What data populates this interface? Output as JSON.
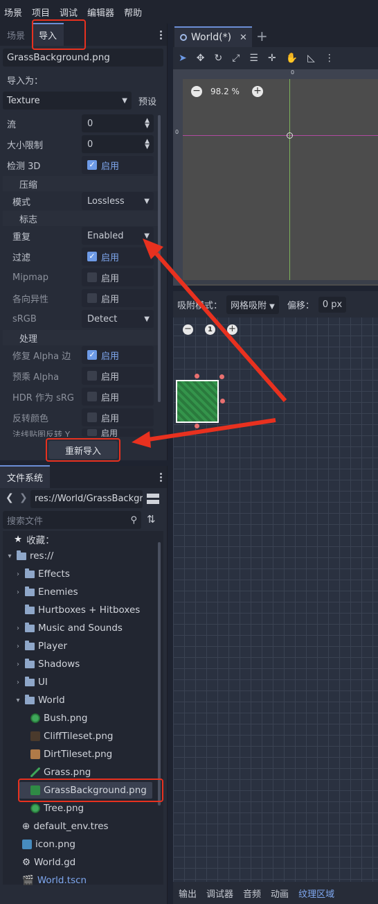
{
  "menu": [
    "场景",
    "项目",
    "调试",
    "编辑器",
    "帮助"
  ],
  "left_tabs": {
    "scene": "场景",
    "import": "导入"
  },
  "import": {
    "file_name": "GrassBackground.png",
    "import_as_label": "导入为：",
    "import_type": "Texture",
    "preset_label": "预设",
    "rows": {
      "stream": {
        "label": "流",
        "value": "0"
      },
      "size_limit": {
        "label": "大小限制",
        "value": "0"
      },
      "detect_3d": {
        "label": "检测 3D",
        "value": "启用"
      },
      "compress_section": "压缩",
      "mode": {
        "label": "模式",
        "value": "Lossless"
      },
      "flags_section": "标志",
      "repeat": {
        "label": "重复",
        "value": "Enabled"
      },
      "filter": {
        "label": "过滤",
        "value": "启用"
      },
      "mipmap": {
        "label": "Mipmap",
        "value": "启用"
      },
      "anisotropic": {
        "label": "各向异性",
        "value": "启用"
      },
      "srgb": {
        "label": "sRGB",
        "value": "Detect"
      },
      "process_section": "处理",
      "fix_alpha": {
        "label": "修复 Alpha 边",
        "value": "启用"
      },
      "premult_alpha": {
        "label": "预乘 Alpha",
        "value": "启用"
      },
      "hdr_as_srgb": {
        "label": "HDR 作为 sRG",
        "value": "启用"
      },
      "invert_color": {
        "label": "反转颜色",
        "value": "启用"
      },
      "normal_invert_y": {
        "label": "法线贴图反转 Y",
        "value": "启用"
      }
    },
    "reimport_label": "重新导入"
  },
  "filesystem": {
    "tab_label": "文件系统",
    "path": "res://World/GrassBackgr",
    "search_placeholder": "搜索文件",
    "favorites_label": "收藏：",
    "root_label": "res://",
    "items": [
      {
        "label": "Effects"
      },
      {
        "label": "Enemies"
      },
      {
        "label": "Hurtboxes + Hitboxes"
      },
      {
        "label": "Music and Sounds"
      },
      {
        "label": "Player"
      },
      {
        "label": "Shadows"
      },
      {
        "label": "UI"
      },
      {
        "label": "World"
      },
      {
        "label": "Bush.png"
      },
      {
        "label": "CliffTileset.png"
      },
      {
        "label": "DirtTileset.png"
      },
      {
        "label": "Grass.png"
      },
      {
        "label": "GrassBackground.png"
      },
      {
        "label": "Tree.png"
      },
      {
        "label": "default_env.tres"
      },
      {
        "label": "icon.png"
      },
      {
        "label": "World.gd"
      },
      {
        "label": "World.tscn"
      }
    ]
  },
  "viewport": {
    "scene_tab": "World(*)",
    "zoom": "98.2 %",
    "ruler_zero": "0",
    "snap_label": "吸附模式：",
    "snap_mode": "网格吸附",
    "offset_label": "偏移：",
    "offset_value": "0 px",
    "region_zoom_value": "1"
  },
  "bottom_tabs": [
    "输出",
    "调试器",
    "音频",
    "动画",
    "纹理区域"
  ],
  "colors": {
    "accent": "#6d9ae6",
    "highlight_red": "#e8311f",
    "grass": "#2f8a45"
  }
}
